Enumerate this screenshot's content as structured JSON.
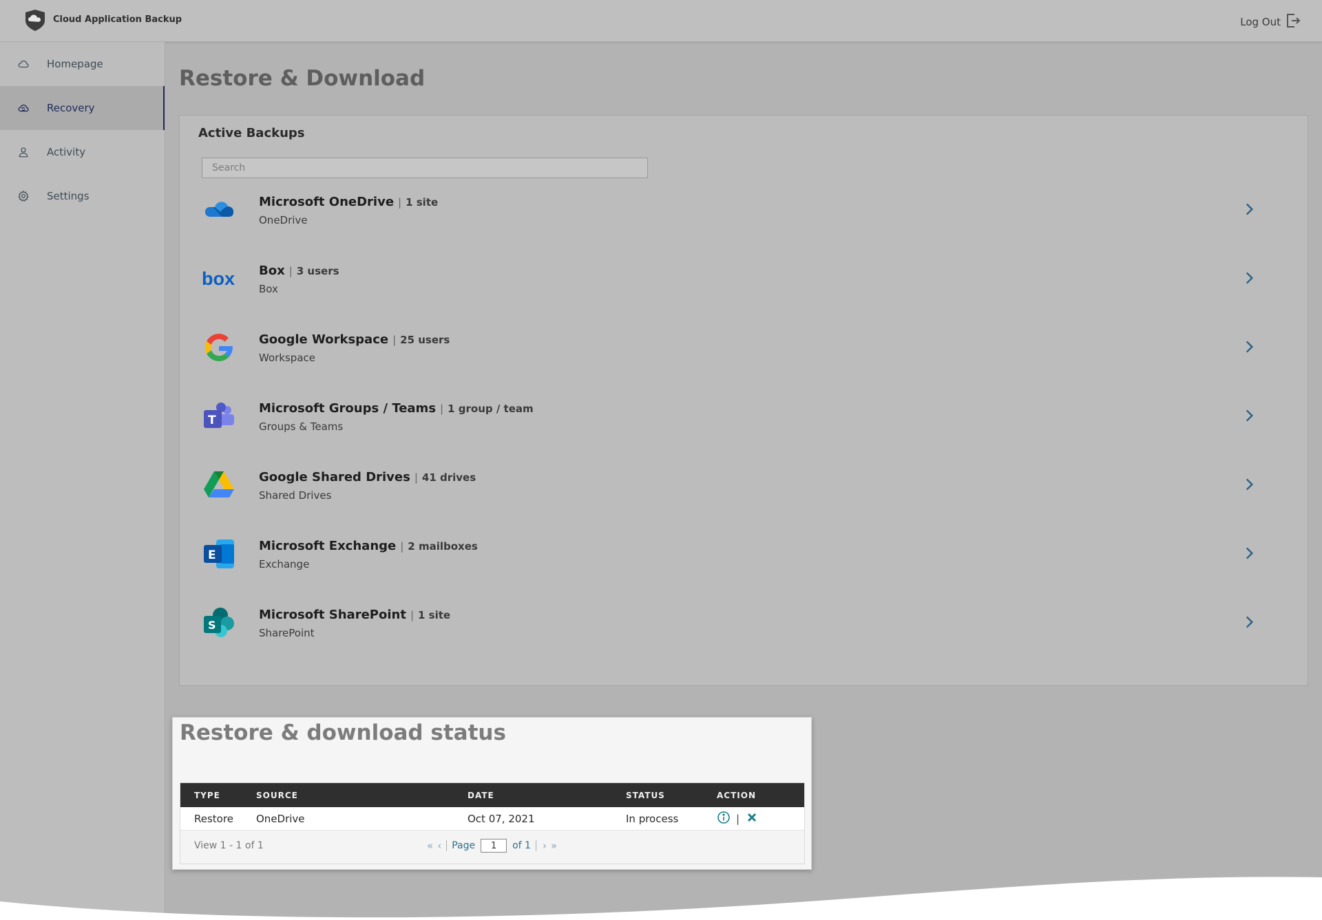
{
  "app": {
    "title": "Cloud Application Backup",
    "logout_label": "Log Out"
  },
  "sidebar": {
    "items": [
      {
        "label": "Homepage",
        "icon": "cloud-icon",
        "active": false
      },
      {
        "label": "Recovery",
        "icon": "cloud-sync-icon",
        "active": true
      },
      {
        "label": "Activity",
        "icon": "user-icon",
        "active": false
      },
      {
        "label": "Settings",
        "icon": "gear-icon",
        "active": false
      }
    ]
  },
  "main": {
    "page_title": "Restore & Download",
    "backups": {
      "title": "Active Backups",
      "search_placeholder": "Search",
      "items": [
        {
          "name": "Microsoft OneDrive",
          "count": "1 site",
          "sub": "OneDrive",
          "icon": "onedrive-icon"
        },
        {
          "name": "Box",
          "count": "3 users",
          "sub": "Box",
          "icon": "box-icon"
        },
        {
          "name": "Google Workspace",
          "count": "25 users",
          "sub": "Workspace",
          "icon": "google-icon"
        },
        {
          "name": "Microsoft Groups / Teams",
          "count": "1 group / team",
          "sub": "Groups & Teams",
          "icon": "teams-icon"
        },
        {
          "name": "Google Shared Drives",
          "count": "41 drives",
          "sub": "Shared Drives",
          "icon": "google-drive-icon"
        },
        {
          "name": "Microsoft Exchange",
          "count": "2 mailboxes",
          "sub": "Exchange",
          "icon": "exchange-icon"
        },
        {
          "name": "Microsoft SharePoint",
          "count": "1 site",
          "sub": "SharePoint",
          "icon": "sharepoint-icon"
        }
      ]
    }
  },
  "status": {
    "title": "Restore & download status",
    "columns": [
      "TYPE",
      "SOURCE",
      "DATE",
      "STATUS",
      "ACTION"
    ],
    "rows": [
      {
        "type": "Restore",
        "source": "OneDrive",
        "date": "Oct 07, 2021",
        "status": "In process"
      }
    ],
    "pager": {
      "view_text": "View 1 - 1 of 1",
      "page_label": "Page",
      "page_value": "1",
      "of_label": "of 1"
    }
  },
  "colors": {
    "accent": "#1f2c5a",
    "action_teal": "#1a7f8a",
    "header_bg": "#bfbfbf",
    "table_header_bg": "#2f2f2f"
  }
}
